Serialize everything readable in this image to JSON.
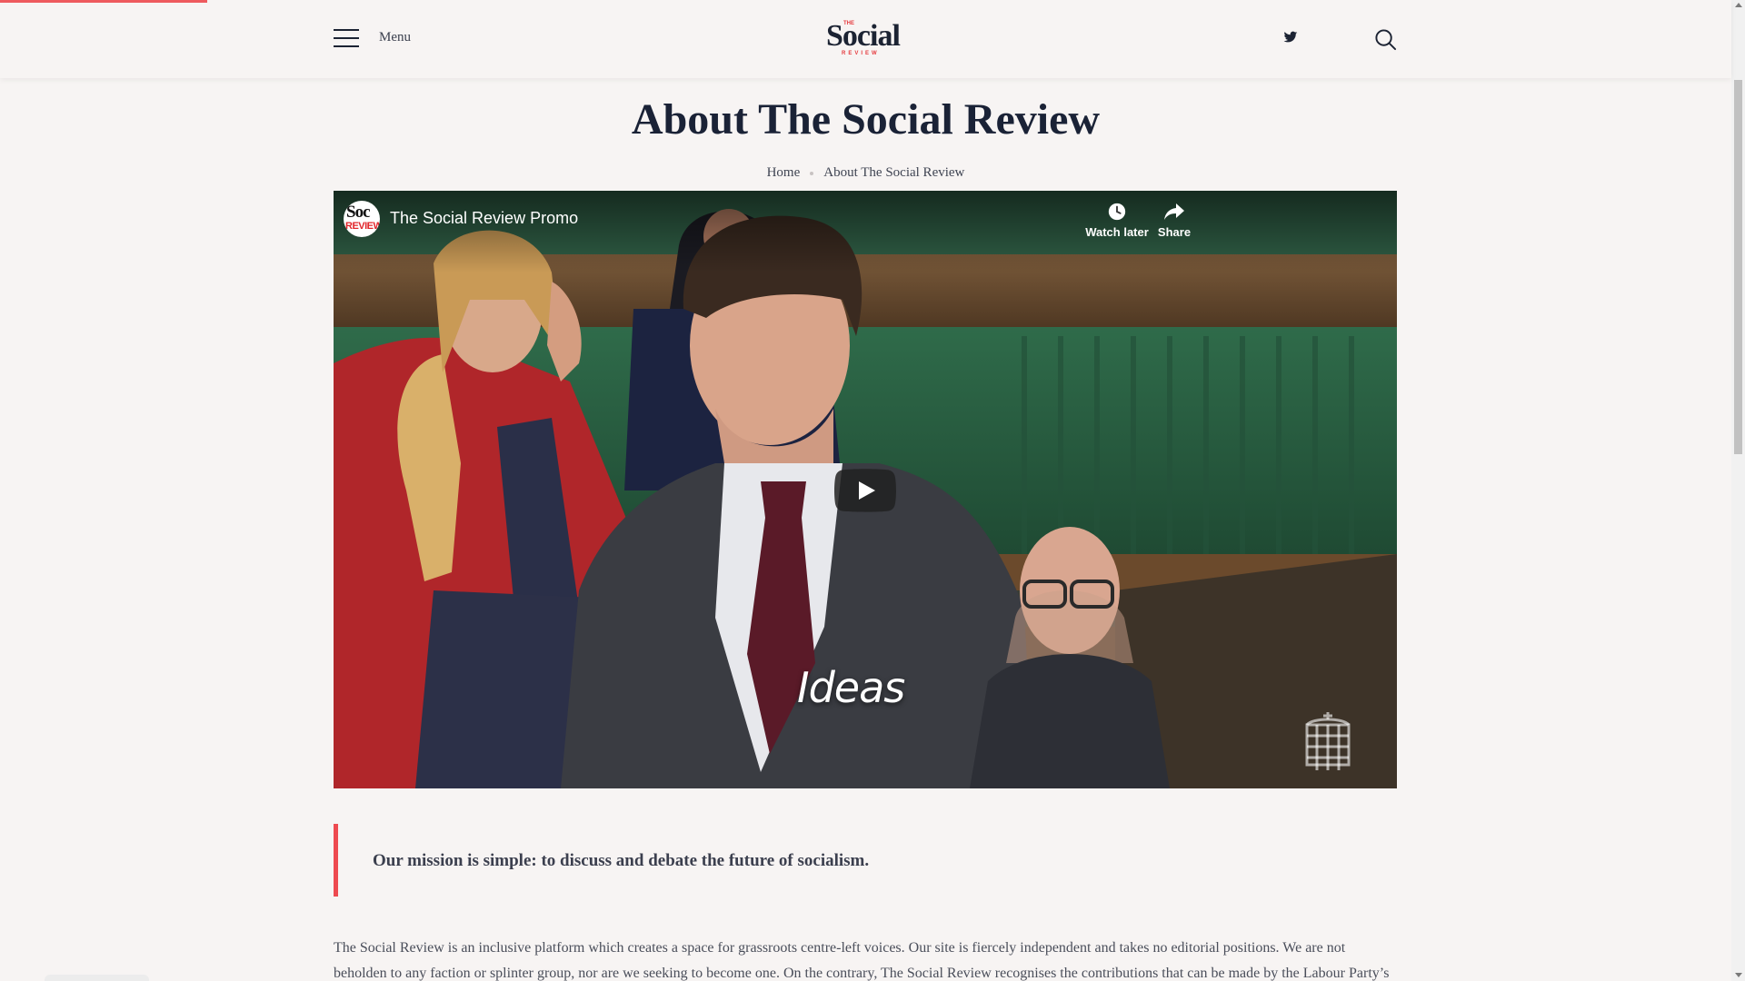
{
  "header": {
    "menu_label": "Menu",
    "logo": {
      "prefix": "THE",
      "main": "Social",
      "suffix": "REVIEW"
    },
    "icons": {
      "twitter": "twitter-icon",
      "search": "search-icon",
      "menu": "hamburger-icon"
    }
  },
  "page": {
    "title": "About The Social Review",
    "breadcrumb": [
      "Home",
      "About The Social Review"
    ]
  },
  "video": {
    "title": "The Social Review Promo",
    "channel_avatar": {
      "line1": "Soc",
      "line2": "REVIEW"
    },
    "watch_later_label": "Watch later",
    "share_label": "Share",
    "caption": "Ideas",
    "icons": {
      "play": "play-icon",
      "watch_later": "clock-icon",
      "share": "share-arrow-icon",
      "watermark": "portcullis-icon"
    }
  },
  "mission": {
    "text": "Our mission is simple: to discuss and debate the future of socialism."
  },
  "body": {
    "paragraph": "The Social Review is an inclusive platform which creates a space for grassroots centre-left voices. Our site is fiercely independent and takes no editorial positions. We are not beholden to any faction or splinter group, nor are we seeking to become one. On the contrary, The Social Review recognises the contributions that can be made by the Labour Party’s many"
  },
  "colors": {
    "background": "#f7f4f3",
    "accent": "#ee4a50",
    "title": "#1a2236",
    "body_text": "#4a4e5a"
  }
}
